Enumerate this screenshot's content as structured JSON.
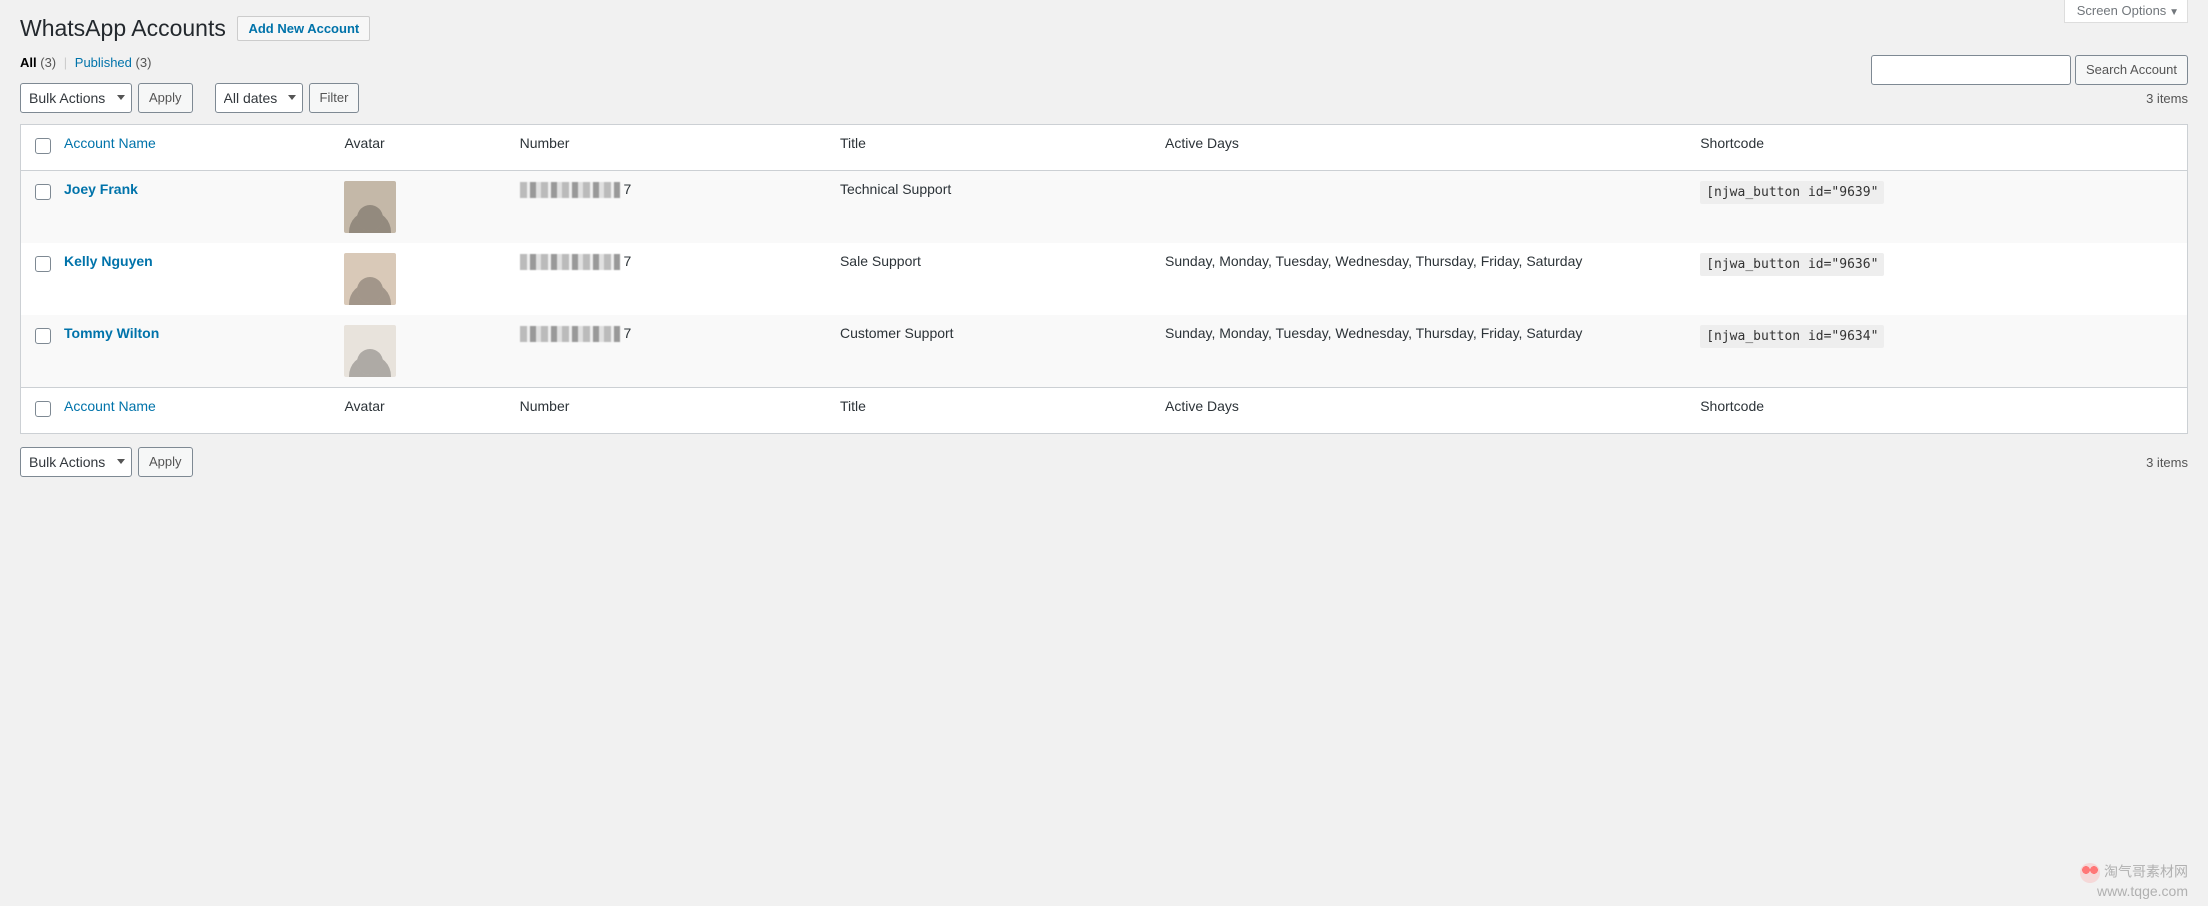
{
  "screen_options": "Screen Options",
  "page_title": "WhatsApp Accounts",
  "add_button": "Add New Account",
  "filters": {
    "all_label": "All",
    "all_count": "(3)",
    "published_label": "Published",
    "published_count": "(3)"
  },
  "bulk_actions_label": "Bulk Actions",
  "apply_label": "Apply",
  "date_filter_label": "All dates",
  "filter_label": "Filter",
  "items_count": "3 items",
  "search": {
    "placeholder": "",
    "button": "Search Account"
  },
  "columns": {
    "name": "Account Name",
    "avatar": "Avatar",
    "number": "Number",
    "title": "Title",
    "active_days": "Active Days",
    "shortcode": "Shortcode"
  },
  "rows": [
    {
      "name": "Joey Frank",
      "number_visible_suffix": "7",
      "title": "Technical Support",
      "active_days": "",
      "shortcode": "[njwa_button id=\"9639\""
    },
    {
      "name": "Kelly Nguyen",
      "number_visible_suffix": "7",
      "title": "Sale Support",
      "active_days": "Sunday, Monday, Tuesday, Wednesday, Thursday, Friday, Saturday",
      "shortcode": "[njwa_button id=\"9636\""
    },
    {
      "name": "Tommy Wilton",
      "number_visible_suffix": "7",
      "title": "Customer Support",
      "active_days": "Sunday, Monday, Tuesday, Wednesday, Thursday, Friday, Saturday",
      "shortcode": "[njwa_button id=\"9634\""
    }
  ],
  "watermark": {
    "line1": "淘气哥素材网",
    "line2": "www.tqge.com"
  }
}
